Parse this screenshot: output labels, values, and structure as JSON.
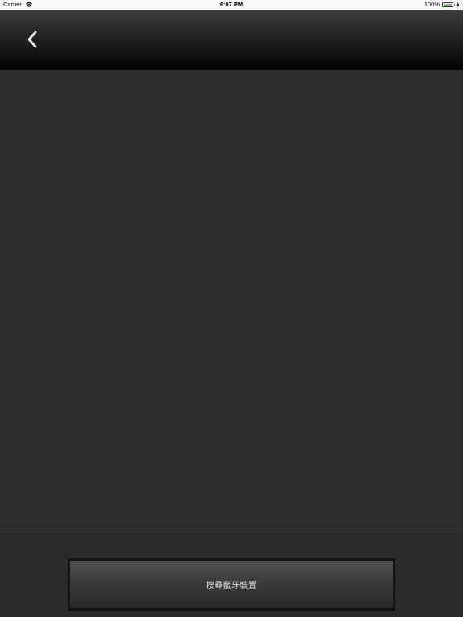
{
  "status_bar": {
    "carrier": "Carrier",
    "time": "6:07 PM",
    "battery_percent": "100%",
    "battery_level": 1.0,
    "wifi_icon": "wifi-icon",
    "charging_icon": "charging-icon"
  },
  "nav_bar": {
    "back_icon": "chevron-left-icon"
  },
  "bottom": {
    "search_button_label": "搜尋藍牙裝置"
  },
  "colors": {
    "background": "#2e2e2e",
    "battery_fill": "#4cd964",
    "button_text": "#e6e6e6"
  }
}
